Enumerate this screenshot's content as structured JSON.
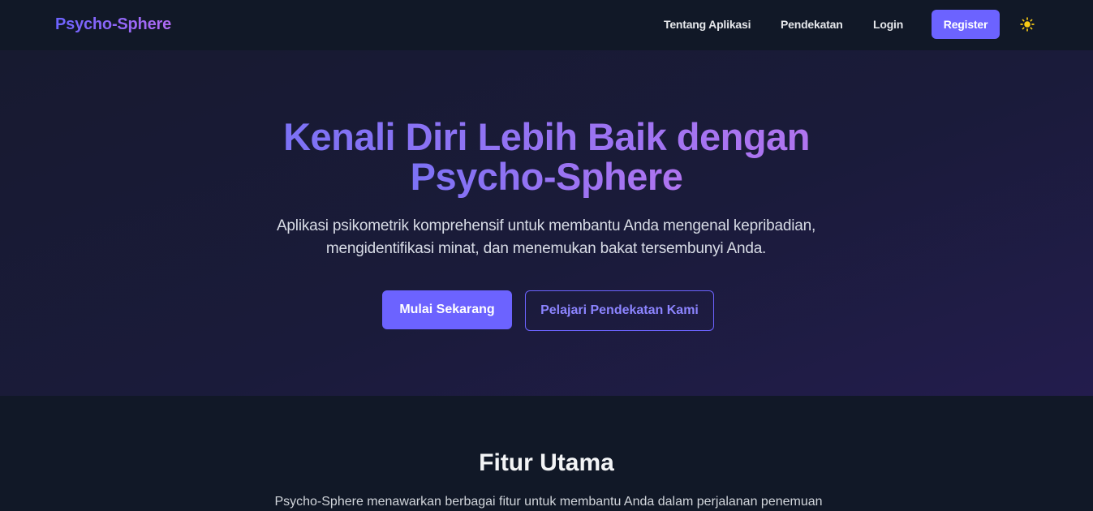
{
  "nav": {
    "brand": "Psycho-Sphere",
    "links": [
      "Tentang Aplikasi",
      "Pendekatan",
      "Login"
    ],
    "register": "Register",
    "theme_icon": "sun-icon"
  },
  "hero": {
    "title_line1": "Kenali Diri Lebih Baik dengan",
    "title_line2": "Psycho-Sphere",
    "description": "Aplikasi psikometrik komprehensif untuk membantu Anda mengenal kepribadian, mengidentifikasi minat, dan menemukan bakat tersembunyi Anda.",
    "cta_primary": "Mulai Sekarang",
    "cta_secondary": "Pelajari Pendekatan Kami"
  },
  "features": {
    "title": "Fitur Utama",
    "description": "Psycho-Sphere menawarkan berbagai fitur untuk membantu Anda dalam perjalanan penemuan"
  },
  "colors": {
    "accent": "#6c63ff",
    "background": "#111827",
    "hero_gradient_end": "#231c4d",
    "sun": "#facc15"
  }
}
